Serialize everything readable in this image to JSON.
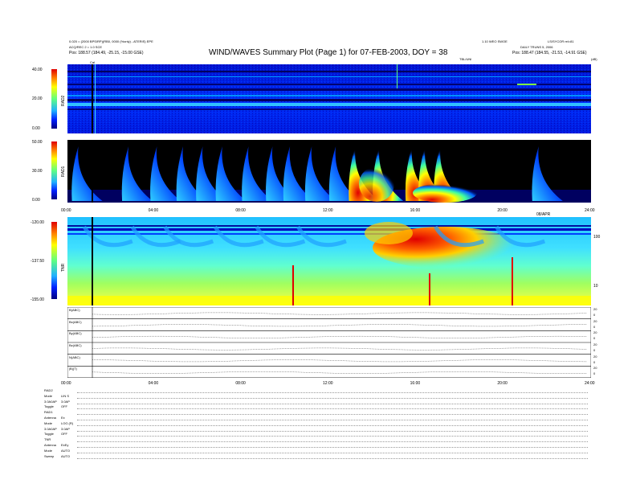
{
  "header": {
    "title": "WIND/WAVES Summary Plot (Page 1) for 07-FEB-2003, DOY = 38",
    "left_line1": "0.020 = (2000 BPS/RP)(RB0, 0000 (%only) - ATERIS) EPE",
    "left_line2": "ACQ/REC 2 = 1.0 SCE",
    "left_pos": "Pos:   188.57 (184.49, -25.15, -15.00  GSE)",
    "right_line1": "1.10 WEO SWOE",
    "right_line2": "LS/SYCOR rel=81",
    "right_line3": "DAILY TRUNS 5, 2006",
    "right_pos": "Pos:   188.47 (184.55, -21.53, -14.91  GSE)",
    "top_center_tag": "TBL/UNI",
    "top_right_tag": "(dB)",
    "cal_marker": "Cal"
  },
  "colors": {
    "dark_blue": "#0000a0",
    "blue": "#0020ff",
    "cyan": "#20d8ff",
    "green": "#a0ff40",
    "yellow": "#ffff00",
    "orange": "#ff8000",
    "red": "#e00000",
    "black": "#000000"
  },
  "chart_data": [
    {
      "type": "heatmap",
      "id": "rad2",
      "ylabel": "RAD2",
      "yticks": [
        "40.00",
        "20.00",
        "0.00"
      ],
      "ylim": [
        0,
        40
      ],
      "xlim": [
        0,
        24
      ],
      "description_free": true
    },
    {
      "type": "heatmap",
      "id": "rad1",
      "ylabel": "RAD1",
      "yticks": [
        "50.00",
        "30.00",
        "0.00"
      ],
      "ylim": [
        0,
        50
      ],
      "xlim": [
        0,
        24
      ],
      "xticks": [
        "00:00",
        "04:00",
        "08:00",
        "12:00",
        "16:00",
        "20:00",
        "24:00"
      ],
      "x_tag": "08/APR",
      "bursts_hours": [
        0.5,
        2.8,
        4.1,
        5.3,
        6.2,
        7.1,
        8.3,
        9.4,
        10.2,
        11.2,
        12.3,
        13.2,
        14.3,
        15.8,
        16.4,
        17.1,
        21.6
      ]
    },
    {
      "type": "heatmap",
      "id": "tnr",
      "ylabel": "TNR",
      "yticks": [
        "-120.00",
        "-137.50",
        "-155.00"
      ],
      "ylim": [
        -155,
        -120
      ],
      "right_ticks": [
        "100",
        "10"
      ],
      "xlim": [
        0,
        24
      ]
    },
    {
      "type": "line",
      "id": "mag",
      "rows": [
        {
          "label": "B(ABC)",
          "right": [
            "20",
            "0"
          ]
        },
        {
          "label": "Bx(ABC)",
          "right": [
            "20",
            "0"
          ]
        },
        {
          "label": "By(ABC)",
          "right": [
            "20",
            "0"
          ]
        },
        {
          "label": "Bz(ABC)",
          "right": [
            "20",
            "0"
          ]
        },
        {
          "label": "N(ABC)",
          "right": [
            "20",
            "0"
          ]
        },
        {
          "label": "|B|(T)",
          "right": [
            "20",
            "0"
          ]
        }
      ],
      "xticks": [
        "00:00",
        "04:00",
        "08:00",
        "12:00",
        "16:00",
        "20:00",
        "24:00"
      ],
      "xlim": [
        0,
        24
      ]
    }
  ],
  "colorbars": {
    "rad2": {
      "label": "RAD2"
    },
    "rad1": {
      "label": "RAD1"
    },
    "tnr": {
      "label": "TNR"
    }
  },
  "footer": {
    "rows": [
      {
        "k": "RAD2",
        "v": ""
      },
      {
        "k": "Mode",
        "v": "LIN S"
      },
      {
        "k": "3.0A0AP",
        "v": "3.0AP"
      },
      {
        "k": "Toggle",
        "v": "OFF"
      },
      {
        "k": "RAD1",
        "v": ""
      },
      {
        "k": "Antenna",
        "v": "Ex"
      },
      {
        "k": "Mode",
        "v": "LOG (R)"
      },
      {
        "k": "3.0A0AP",
        "v": "3.0AP"
      },
      {
        "k": "Toggle",
        "v": "OFF"
      },
      {
        "k": "TNR",
        "v": ""
      },
      {
        "k": "Antenna",
        "v": "ExEy"
      },
      {
        "k": "Mode",
        "v": "AUTO"
      },
      {
        "k": "Sweep",
        "v": "AUTO"
      }
    ]
  }
}
